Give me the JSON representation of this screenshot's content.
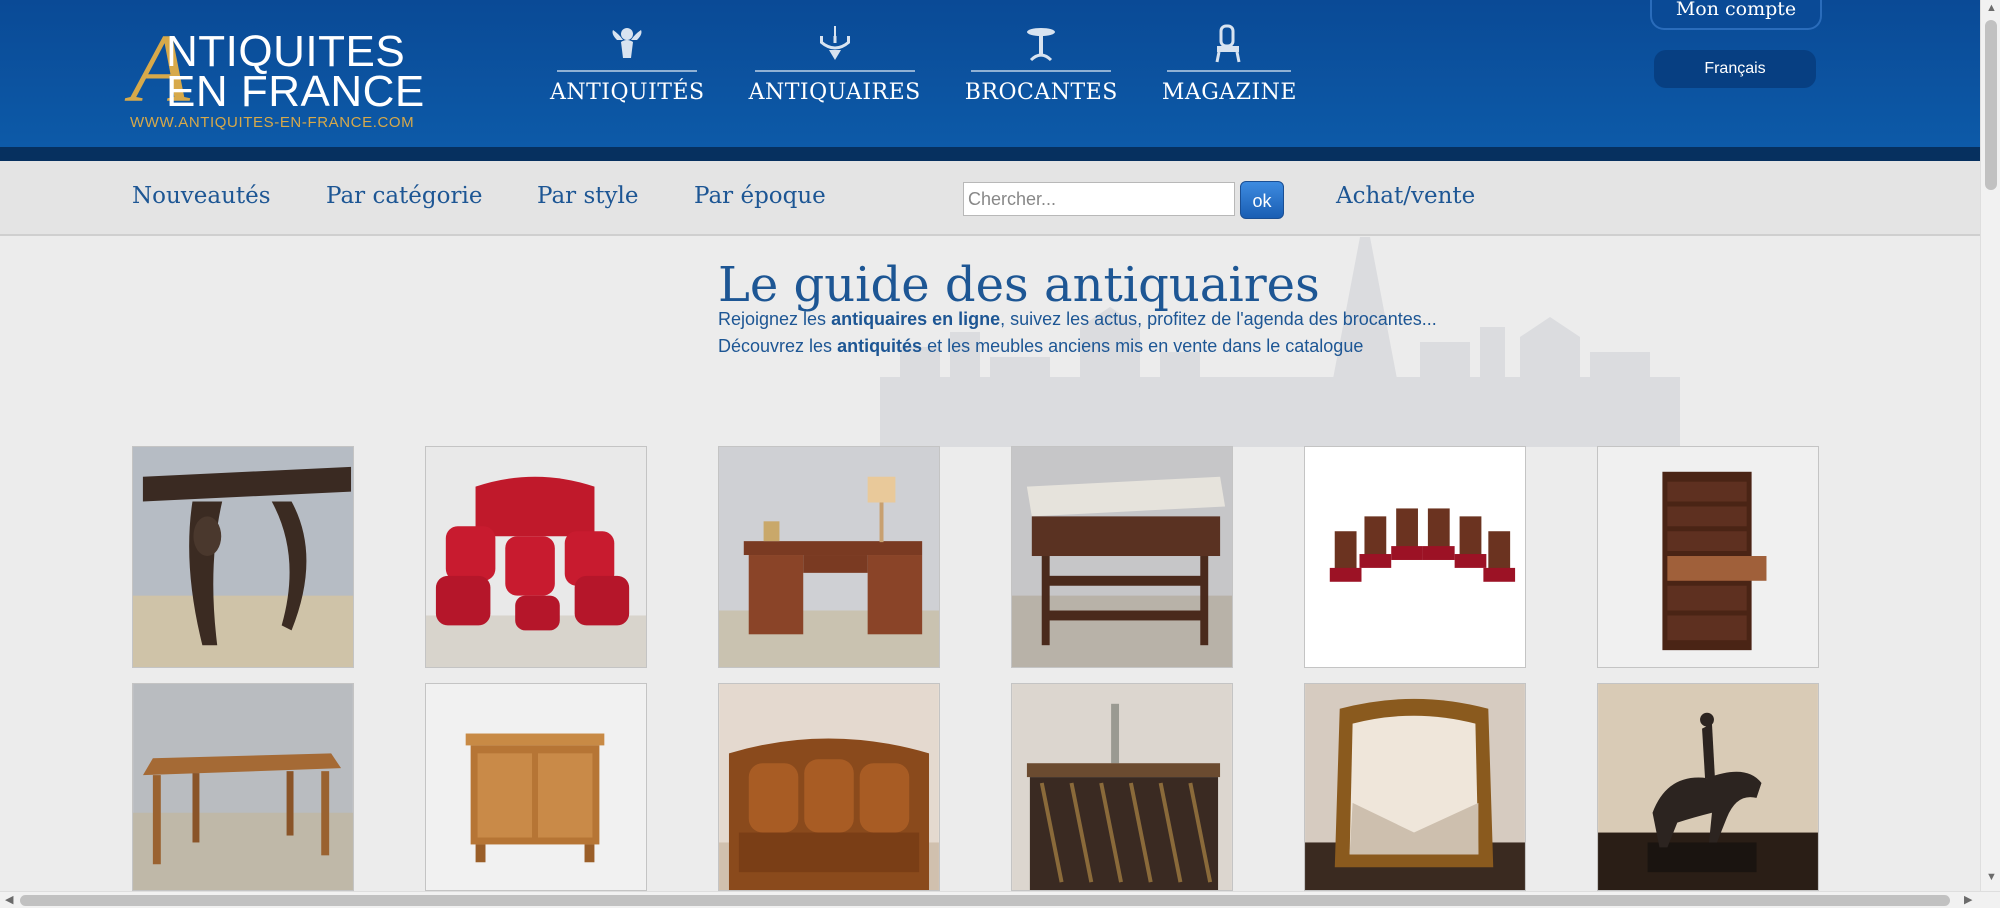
{
  "header": {
    "logo": {
      "initial": "A",
      "line1": "NTIQUITES",
      "line2": "EN FRANCE",
      "url": "WWW.ANTIQUITES-EN-FRANCE.COM"
    },
    "nav": [
      {
        "label": "ANTIQUITÉS",
        "icon": "cherub-icon"
      },
      {
        "label": "ANTIQUAIRES",
        "icon": "chandelier-icon"
      },
      {
        "label": "BROCANTES",
        "icon": "gueridon-table-icon"
      },
      {
        "label": "MAGAZINE",
        "icon": "armchair-icon"
      }
    ],
    "account_label": "Mon compte",
    "language": "Français"
  },
  "subnav": {
    "links": [
      "Nouveautés",
      "Par catégorie",
      "Par style",
      "Par époque"
    ],
    "search_placeholder": "Chercher...",
    "search_button": "ok",
    "sell_link": "Achat/vente"
  },
  "main": {
    "title": "Le guide des antiquaires",
    "intro_line1": {
      "pre": "Rejoignez les ",
      "bold": "antiquaires en ligne",
      "post": ", suivez les actus, profitez de l'agenda des brocantes..."
    },
    "intro_line2": {
      "pre": "Découvrez les ",
      "bold": "antiquités",
      "post": " et les meubles anciens mis en vente dans le catalogue"
    },
    "products": [
      {
        "name": "carved-console-table",
        "bg": "#b6bcc4"
      },
      {
        "name": "red-salon-set",
        "bg": "#e9e9e9"
      },
      {
        "name": "writing-desk",
        "bg": "#cfd0d4"
      },
      {
        "name": "marble-top-server",
        "bg": "#c6c6c8"
      },
      {
        "name": "six-red-chairs",
        "bg": "#ffffff"
      },
      {
        "name": "secretary-chest",
        "bg": "#f0f0f0"
      },
      {
        "name": "farm-table",
        "bg": "#b9bcc0"
      },
      {
        "name": "sideboard",
        "bg": "#f1f1f1"
      },
      {
        "name": "leather-sofa",
        "bg": "#e4d9cf"
      },
      {
        "name": "bar-counter",
        "bg": "#dcd6cf"
      },
      {
        "name": "gilded-mirror",
        "bg": "#d6cbc0"
      },
      {
        "name": "horse-rider-bronze",
        "bg": "#d9cbb6"
      }
    ]
  },
  "colors": {
    "header_blue": "#0a4a96",
    "header_band": "#06305f",
    "link_blue": "#1d5694",
    "logo_gold": "#d7a94a"
  }
}
